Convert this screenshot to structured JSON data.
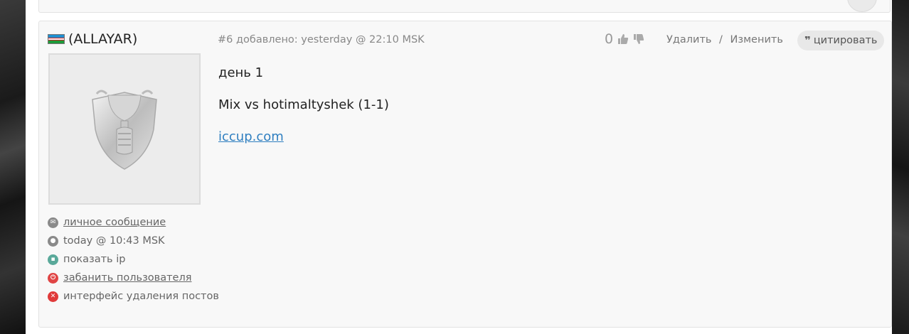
{
  "author": {
    "name": "(ALLAYAR)",
    "flag_icon": "flag-uz-icon"
  },
  "post": {
    "header": "#6 добавлено: yesterday @ 22:10 MSK",
    "rating": "0",
    "delete_label": "Удалить",
    "separator": "/",
    "edit_label": "Изменить",
    "quote_label": "цитировать",
    "lines": [
      "день 1",
      "Mix vs hotimaltyshek (1-1)"
    ],
    "link": "iccup.com"
  },
  "meta": {
    "message": "личное сообщение",
    "time": "today @ 10:43 MSK",
    "show_ip": "показать ip",
    "ban": "забанить пользователя",
    "delete_ui": "интерфейс удаления постов"
  },
  "colors": {
    "link": "#2f7fc0",
    "ban_icon": "#e04545",
    "ip_icon": "#5aa99a"
  }
}
